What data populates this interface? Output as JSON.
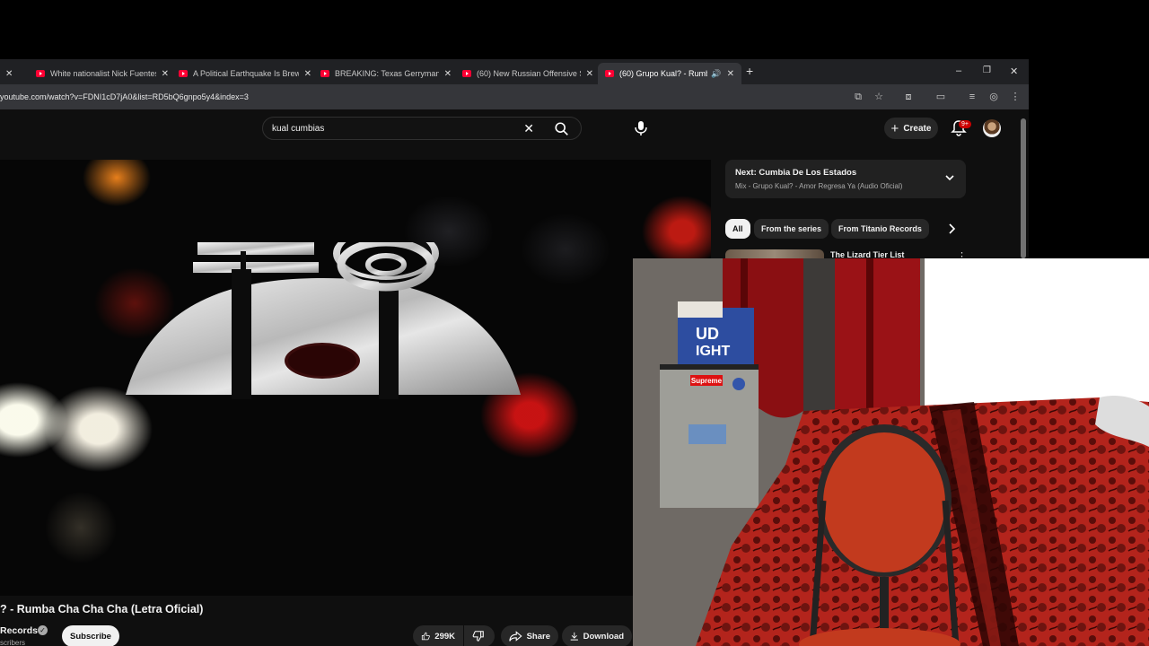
{
  "browser": {
    "tabs": [
      {
        "title": "White nationalist Nick Fuentes"
      },
      {
        "title": "A Political Earthquake Is Brewin"
      },
      {
        "title": "BREAKING: Texas Gerrymander"
      },
      {
        "title": "(60) New Russian Offensive STU"
      },
      {
        "title": "(60) Grupo Kual? - Rumba"
      }
    ],
    "new_tab": "+",
    "url": "youtube.com/watch?v=FDNI1cD7jA0&list=RD5bQ6gnpo5y4&index=3"
  },
  "youtube": {
    "search_query": "kual cumbias",
    "create_label": "Create",
    "notification_badge": "9+",
    "video": {
      "title": "? - Rumba Cha Cha Cha (Letra Oficial)",
      "channel": "Records",
      "subscribers": "scribers",
      "subscribe_label": "Subscribe",
      "likes": "299K",
      "share_label": "Share",
      "download_label": "Download"
    },
    "sidebar": {
      "next_label": "Next: Cumbia De Los Estados",
      "next_mix": "Mix - Grupo Kual? - Amor Regresa Ya (Audio Oficial)",
      "chips": [
        "All",
        "From the series",
        "From Titanio Records"
      ],
      "first_video_title": "The Lizard Tier List"
    }
  },
  "webcam": {
    "box_text": "UD\nIGHT",
    "fridge_logo": "Supreme"
  },
  "colors": {
    "youtube_red": "#ff0033",
    "background": "#0f0f0f",
    "bed_red": "#b3241c"
  }
}
